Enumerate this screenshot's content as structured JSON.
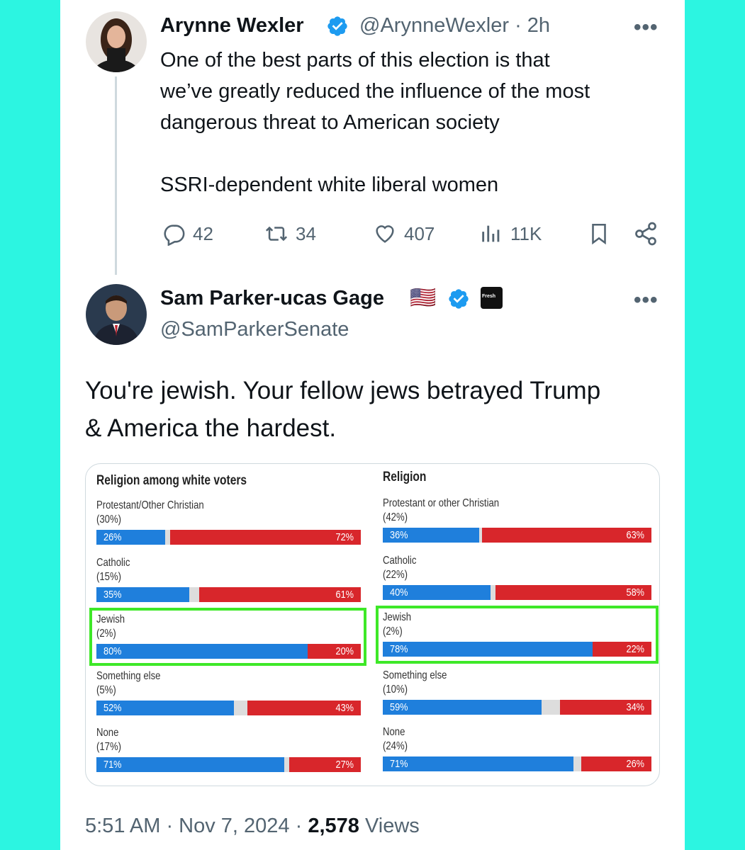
{
  "tweet1": {
    "name": "Arynne Wexler",
    "handle": "@ArynneWexler · 2h",
    "more": "•••",
    "text": "One of the best parts of this election is that\nwe’ve greatly reduced the influence of the most\ndangerous threat to American society\n\nSSRI-dependent white liberal women",
    "stats": {
      "replies": "42",
      "reposts": "34",
      "likes": "407",
      "views": "11K"
    }
  },
  "tweet2": {
    "name": "Sam Parker-ucas Gage",
    "handle": "@SamParkerSenate",
    "more": "•••",
    "flag_emoji": "🇺🇸",
    "affiliate_badge_text": "Fresh",
    "text": "You're jewish. Your fellow jews betrayed Trump\n& America the hardest.",
    "footer_time": "5:51 AM · Nov 7, 2024 · ",
    "footer_views_count": "2,578",
    "footer_views_label": " Views"
  },
  "colors": {
    "accent_blue": "#1d9bf0",
    "dem_blue": "#1f7fdc",
    "rep_red": "#d8262b",
    "highlight_green": "#3ee828",
    "background": "#2cf5e1"
  },
  "chart_data": [
    {
      "type": "bar",
      "title": "Religion among white voters",
      "categories": [
        {
          "label": "Protestant/Other Christian",
          "share": "(30%)",
          "left_pct": 26,
          "right_pct": 72,
          "left_text": "26%",
          "right_text": "72%"
        },
        {
          "label": "Catholic",
          "share": "(15%)",
          "left_pct": 35,
          "right_pct": 61,
          "left_text": "35%",
          "right_text": "61%"
        },
        {
          "label": "Jewish",
          "share": "(2%)",
          "left_pct": 80,
          "right_pct": 20,
          "left_text": "80%",
          "right_text": "20%",
          "highlighted": true
        },
        {
          "label": "Something else",
          "share": "(5%)",
          "left_pct": 52,
          "right_pct": 43,
          "left_text": "52%",
          "right_text": "43%"
        },
        {
          "label": "None",
          "share": "(17%)",
          "left_pct": 71,
          "right_pct": 27,
          "left_text": "71%",
          "right_text": "27%"
        }
      ]
    },
    {
      "type": "bar",
      "title": "Religion",
      "categories": [
        {
          "label": "Protestant or other Christian",
          "share": "(42%)",
          "left_pct": 36,
          "right_pct": 63,
          "left_text": "36%",
          "right_text": "63%"
        },
        {
          "label": "Catholic",
          "share": "(22%)",
          "left_pct": 40,
          "right_pct": 58,
          "left_text": "40%",
          "right_text": "58%"
        },
        {
          "label": "Jewish",
          "share": "(2%)",
          "left_pct": 78,
          "right_pct": 22,
          "left_text": "78%",
          "right_text": "22%",
          "highlighted": true
        },
        {
          "label": "Something else",
          "share": "(10%)",
          "left_pct": 59,
          "right_pct": 34,
          "left_text": "59%",
          "right_text": "34%"
        },
        {
          "label": "None",
          "share": "(24%)",
          "left_pct": 71,
          "right_pct": 26,
          "left_text": "71%",
          "right_text": "26%"
        }
      ]
    }
  ]
}
